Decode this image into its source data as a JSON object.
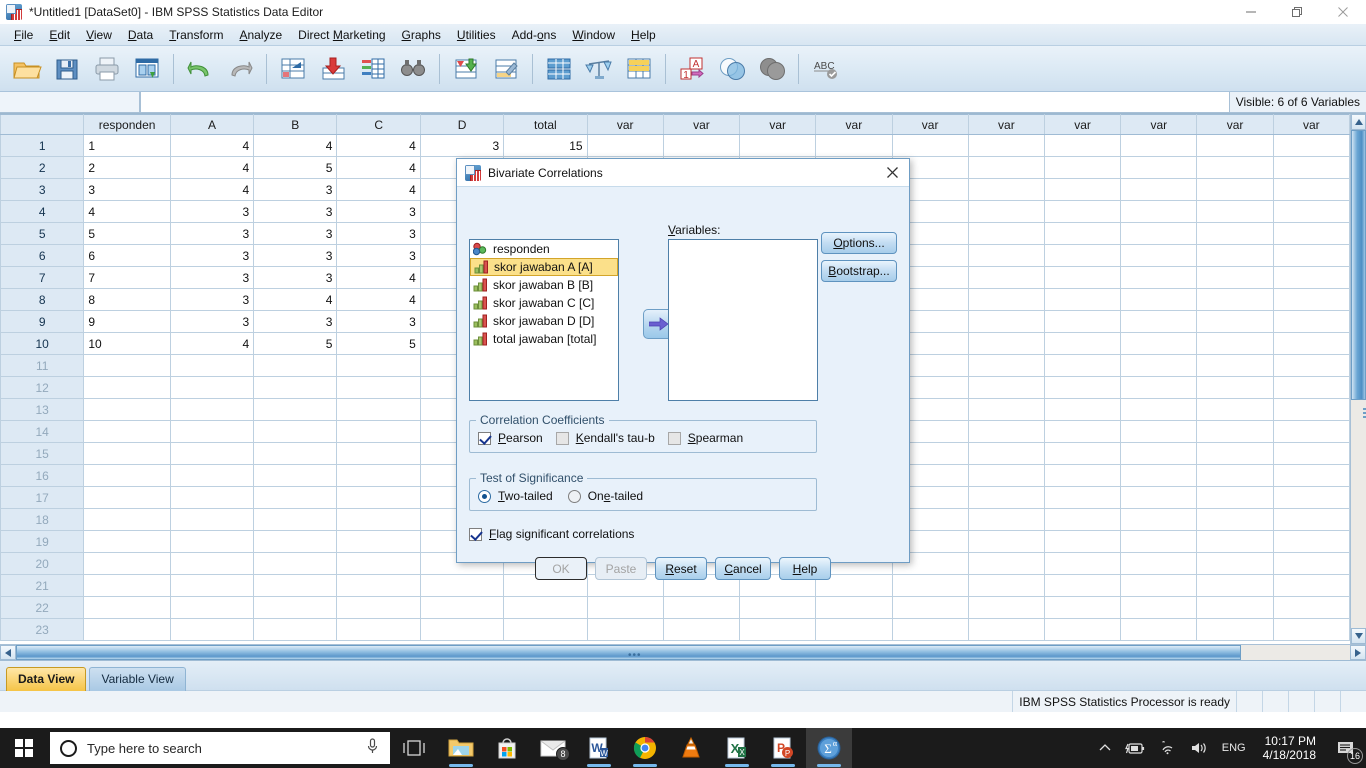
{
  "window": {
    "title": "*Untitled1 [DataSet0] - IBM SPSS Statistics Data Editor",
    "minimize": "minimize-icon",
    "restore": "restore-icon",
    "close": "close-icon"
  },
  "menubar": [
    {
      "label": "File",
      "accel": "F"
    },
    {
      "label": "Edit",
      "accel": "E"
    },
    {
      "label": "View",
      "accel": "V"
    },
    {
      "label": "Data",
      "accel": "D"
    },
    {
      "label": "Transform",
      "accel": "T"
    },
    {
      "label": "Analyze",
      "accel": "A"
    },
    {
      "label": "Direct Marketing",
      "accel": "M"
    },
    {
      "label": "Graphs",
      "accel": "G"
    },
    {
      "label": "Utilities",
      "accel": "U"
    },
    {
      "label": "Add-ons",
      "accel": "o"
    },
    {
      "label": "Window",
      "accel": "W"
    },
    {
      "label": "Help",
      "accel": "H"
    }
  ],
  "toolbar": {
    "buttons": [
      "open-file-icon",
      "save-icon",
      "print-icon",
      "recall-dialogs-icon",
      "undo-icon",
      "redo-icon",
      "goto-case-icon",
      "goto-variable-icon",
      "variables-icon",
      "find-icon",
      "insert-case-icon",
      "insert-variable-icon",
      "split-file-icon",
      "weight-cases-icon",
      "select-cases-icon",
      "value-labels-icon",
      "use-variable-sets-icon",
      "show-all-variables-icon",
      "spell-check-icon"
    ]
  },
  "cellbar": {
    "reference": "",
    "value": "",
    "visible_variables": "Visible: 6 of 6 Variables"
  },
  "grid": {
    "columns": [
      "responden",
      "A",
      "B",
      "C",
      "D",
      "total"
    ],
    "empty_column_label": "var",
    "empty_column_count": 10,
    "rows": [
      {
        "num": "1",
        "cells": [
          "1",
          "4",
          "4",
          "4",
          "3",
          "15"
        ]
      },
      {
        "num": "2",
        "cells": [
          "2",
          "4",
          "5",
          "4",
          "",
          ""
        ]
      },
      {
        "num": "3",
        "cells": [
          "3",
          "4",
          "3",
          "4",
          "",
          ""
        ]
      },
      {
        "num": "4",
        "cells": [
          "4",
          "3",
          "3",
          "3",
          "",
          ""
        ]
      },
      {
        "num": "5",
        "cells": [
          "5",
          "3",
          "3",
          "3",
          "",
          ""
        ]
      },
      {
        "num": "6",
        "cells": [
          "6",
          "3",
          "3",
          "3",
          "",
          ""
        ]
      },
      {
        "num": "7",
        "cells": [
          "7",
          "3",
          "3",
          "4",
          "",
          ""
        ]
      },
      {
        "num": "8",
        "cells": [
          "8",
          "3",
          "4",
          "4",
          "",
          ""
        ]
      },
      {
        "num": "9",
        "cells": [
          "9",
          "3",
          "3",
          "3",
          "",
          ""
        ]
      },
      {
        "num": "10",
        "cells": [
          "10",
          "4",
          "5",
          "5",
          "",
          ""
        ]
      },
      {
        "num": "11",
        "cells": [
          "",
          "",
          "",
          "",
          "",
          ""
        ]
      },
      {
        "num": "12",
        "cells": [
          "",
          "",
          "",
          "",
          "",
          ""
        ]
      },
      {
        "num": "13",
        "cells": [
          "",
          "",
          "",
          "",
          "",
          ""
        ]
      },
      {
        "num": "14",
        "cells": [
          "",
          "",
          "",
          "",
          "",
          ""
        ]
      },
      {
        "num": "15",
        "cells": [
          "",
          "",
          "",
          "",
          "",
          ""
        ]
      },
      {
        "num": "16",
        "cells": [
          "",
          "",
          "",
          "",
          "",
          ""
        ]
      },
      {
        "num": "17",
        "cells": [
          "",
          "",
          "",
          "",
          "",
          ""
        ]
      },
      {
        "num": "18",
        "cells": [
          "",
          "",
          "",
          "",
          "",
          ""
        ]
      },
      {
        "num": "19",
        "cells": [
          "",
          "",
          "",
          "",
          "",
          ""
        ]
      },
      {
        "num": "20",
        "cells": [
          "",
          "",
          "",
          "",
          "",
          ""
        ]
      },
      {
        "num": "21",
        "cells": [
          "",
          "",
          "",
          "",
          "",
          ""
        ]
      },
      {
        "num": "22",
        "cells": [
          "",
          "",
          "",
          "",
          "",
          ""
        ]
      },
      {
        "num": "23",
        "cells": [
          "",
          "",
          "",
          "",
          "",
          ""
        ]
      }
    ]
  },
  "view_tabs": [
    {
      "label": "Data View",
      "active": true
    },
    {
      "label": "Variable View",
      "active": false
    }
  ],
  "statusbar": {
    "message": "IBM SPSS Statistics Processor is ready"
  },
  "dialog": {
    "title": "Bivariate Correlations",
    "icon": "spss-dialog-icon",
    "close": "close-icon",
    "source_variables": [
      {
        "label": "responden",
        "icon": "nominal-variable-icon",
        "selected": false
      },
      {
        "label": "skor jawaban A [A]",
        "icon": "scale-variable-icon",
        "selected": true
      },
      {
        "label": "skor jawaban B [B]",
        "icon": "scale-variable-icon",
        "selected": false
      },
      {
        "label": "skor jawaban C [C]",
        "icon": "scale-variable-icon",
        "selected": false
      },
      {
        "label": "skor jawaban D [D]",
        "icon": "scale-variable-icon",
        "selected": false
      },
      {
        "label": "total jawaban [total]",
        "icon": "scale-variable-icon",
        "selected": false
      }
    ],
    "move_button": "move-right-arrow-icon",
    "variables_label": "Variables:",
    "variables_selected": [],
    "side_buttons": [
      {
        "label": "Options...",
        "accel": "O"
      },
      {
        "label": "Bootstrap...",
        "accel": "B"
      }
    ],
    "correlation_coefficients": {
      "legend": "Correlation Coefficients",
      "options": [
        {
          "label": "Pearson",
          "accel": "P",
          "checked": true,
          "enabled": true
        },
        {
          "label": "Kendall's tau-b",
          "accel": "K",
          "checked": false,
          "enabled": false
        },
        {
          "label": "Spearman",
          "accel": "S",
          "checked": false,
          "enabled": false
        }
      ]
    },
    "test_of_significance": {
      "legend": "Test of Significance",
      "options": [
        {
          "label": "Two-tailed",
          "accel": "T",
          "checked": true
        },
        {
          "label": "One-tailed",
          "accel": "e",
          "checked": false
        }
      ]
    },
    "flag_significant": {
      "label": "Flag significant correlations",
      "accel": "F",
      "checked": true
    },
    "buttons": [
      {
        "label": "OK",
        "state": "disabled-default"
      },
      {
        "label": "Paste",
        "state": "disabled"
      },
      {
        "label": "Reset",
        "accel": "R",
        "state": "enabled"
      },
      {
        "label": "Cancel",
        "accel": "C",
        "state": "enabled"
      },
      {
        "label": "Help",
        "accel": "H",
        "state": "enabled"
      }
    ]
  },
  "taskbar": {
    "start": "windows-start-icon",
    "search_placeholder": "Type here to search",
    "mic": "microphone-icon",
    "task_view": "task-view-icon",
    "apps": [
      {
        "name": "file-explorer",
        "badge": ""
      },
      {
        "name": "microsoft-store",
        "badge": ""
      },
      {
        "name": "mail",
        "badge": "8"
      },
      {
        "name": "microsoft-word",
        "badge": ""
      },
      {
        "name": "google-chrome",
        "badge": ""
      },
      {
        "name": "vlc-media-player",
        "badge": ""
      },
      {
        "name": "microsoft-excel",
        "badge": ""
      },
      {
        "name": "microsoft-powerpoint",
        "badge": ""
      },
      {
        "name": "ibm-spss-statistics",
        "badge": ""
      }
    ],
    "tray": {
      "chevron": "show-hidden-icons-icon",
      "battery": "battery-charging-icon",
      "network": "wifi-icon",
      "volume": "speaker-icon",
      "language": "ENG",
      "time": "10:17 PM",
      "date": "4/18/2018",
      "notifications_count": "16"
    }
  },
  "colors": {
    "accent_blue": "#2f6ba5",
    "selection_yellow": "#fbe08a",
    "grid_header": "#dde9f4",
    "dialog_bg": "#e8f1fa",
    "taskbar_bg": "#1b1b1b"
  }
}
